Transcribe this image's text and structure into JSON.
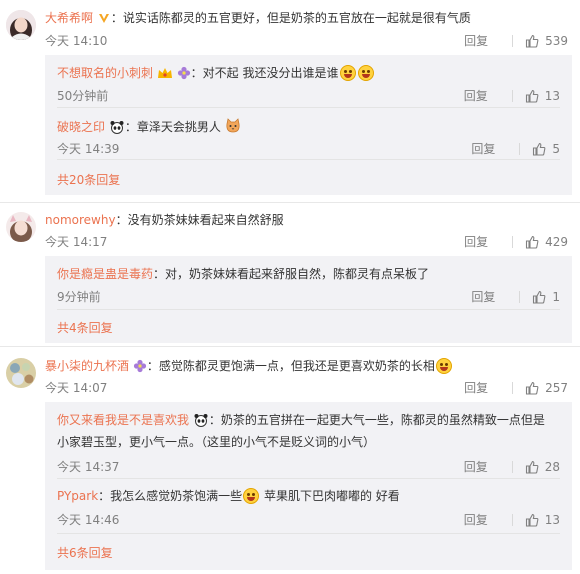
{
  "colors": {
    "username": "#eb7350",
    "meta": "#808080",
    "sub_bg": "#f2f2f5"
  },
  "comments": [
    {
      "user": "大希希啊",
      "text": "：说实话陈都灵的五官更好，但是奶茶的五官放在一起就是很有气质",
      "time": "今天 14:10",
      "reply": "回复",
      "likes": "539",
      "replies": [
        {
          "user": "不想取名的小刺刺",
          "text": "：对不起 我还没分出谁是谁",
          "time": "50分钟前",
          "reply": "回复",
          "likes": "13"
        },
        {
          "user": "破晓之印",
          "text": "：章泽天会挑男人",
          "time": "今天 14:39",
          "reply": "回复",
          "likes": "5"
        }
      ],
      "more": "共20条回复"
    },
    {
      "user": "nomorewhy",
      "text": "：没有奶茶妹妹看起来自然舒服",
      "time": "今天 14:17",
      "reply": "回复",
      "likes": "429",
      "replies": [
        {
          "user": "你是瘾是蛊是毒药",
          "text": "：对，奶茶妹妹看起来舒服自然，陈都灵有点呆板了",
          "time": "9分钟前",
          "reply": "回复",
          "likes": "1"
        }
      ],
      "more": "共4条回复"
    },
    {
      "user": "暴小柒的九杯酒",
      "text": "：感觉陈都灵更饱满一点，但我还是更喜欢奶茶的长相",
      "time": "今天 14:07",
      "reply": "回复",
      "likes": "257",
      "replies": [
        {
          "user": "你又来看我是不是喜欢我",
          "text": "：奶茶的五官拼在一起更大气一些，陈都灵的虽然精致一点但是",
          "text2": "小家碧玉型，更小气一点。（这里的小气不是贬义词的小气）",
          "time": "今天 14:37",
          "reply": "回复",
          "likes": "28"
        },
        {
          "user": "PYpark",
          "text": "：我怎么感觉奶茶饱满一些",
          "text_after": " 苹果肌下巴肉嘟嘟的 好看",
          "time": "今天 14:46",
          "reply": "回复",
          "likes": "13"
        }
      ],
      "more": "共6条回复"
    }
  ]
}
